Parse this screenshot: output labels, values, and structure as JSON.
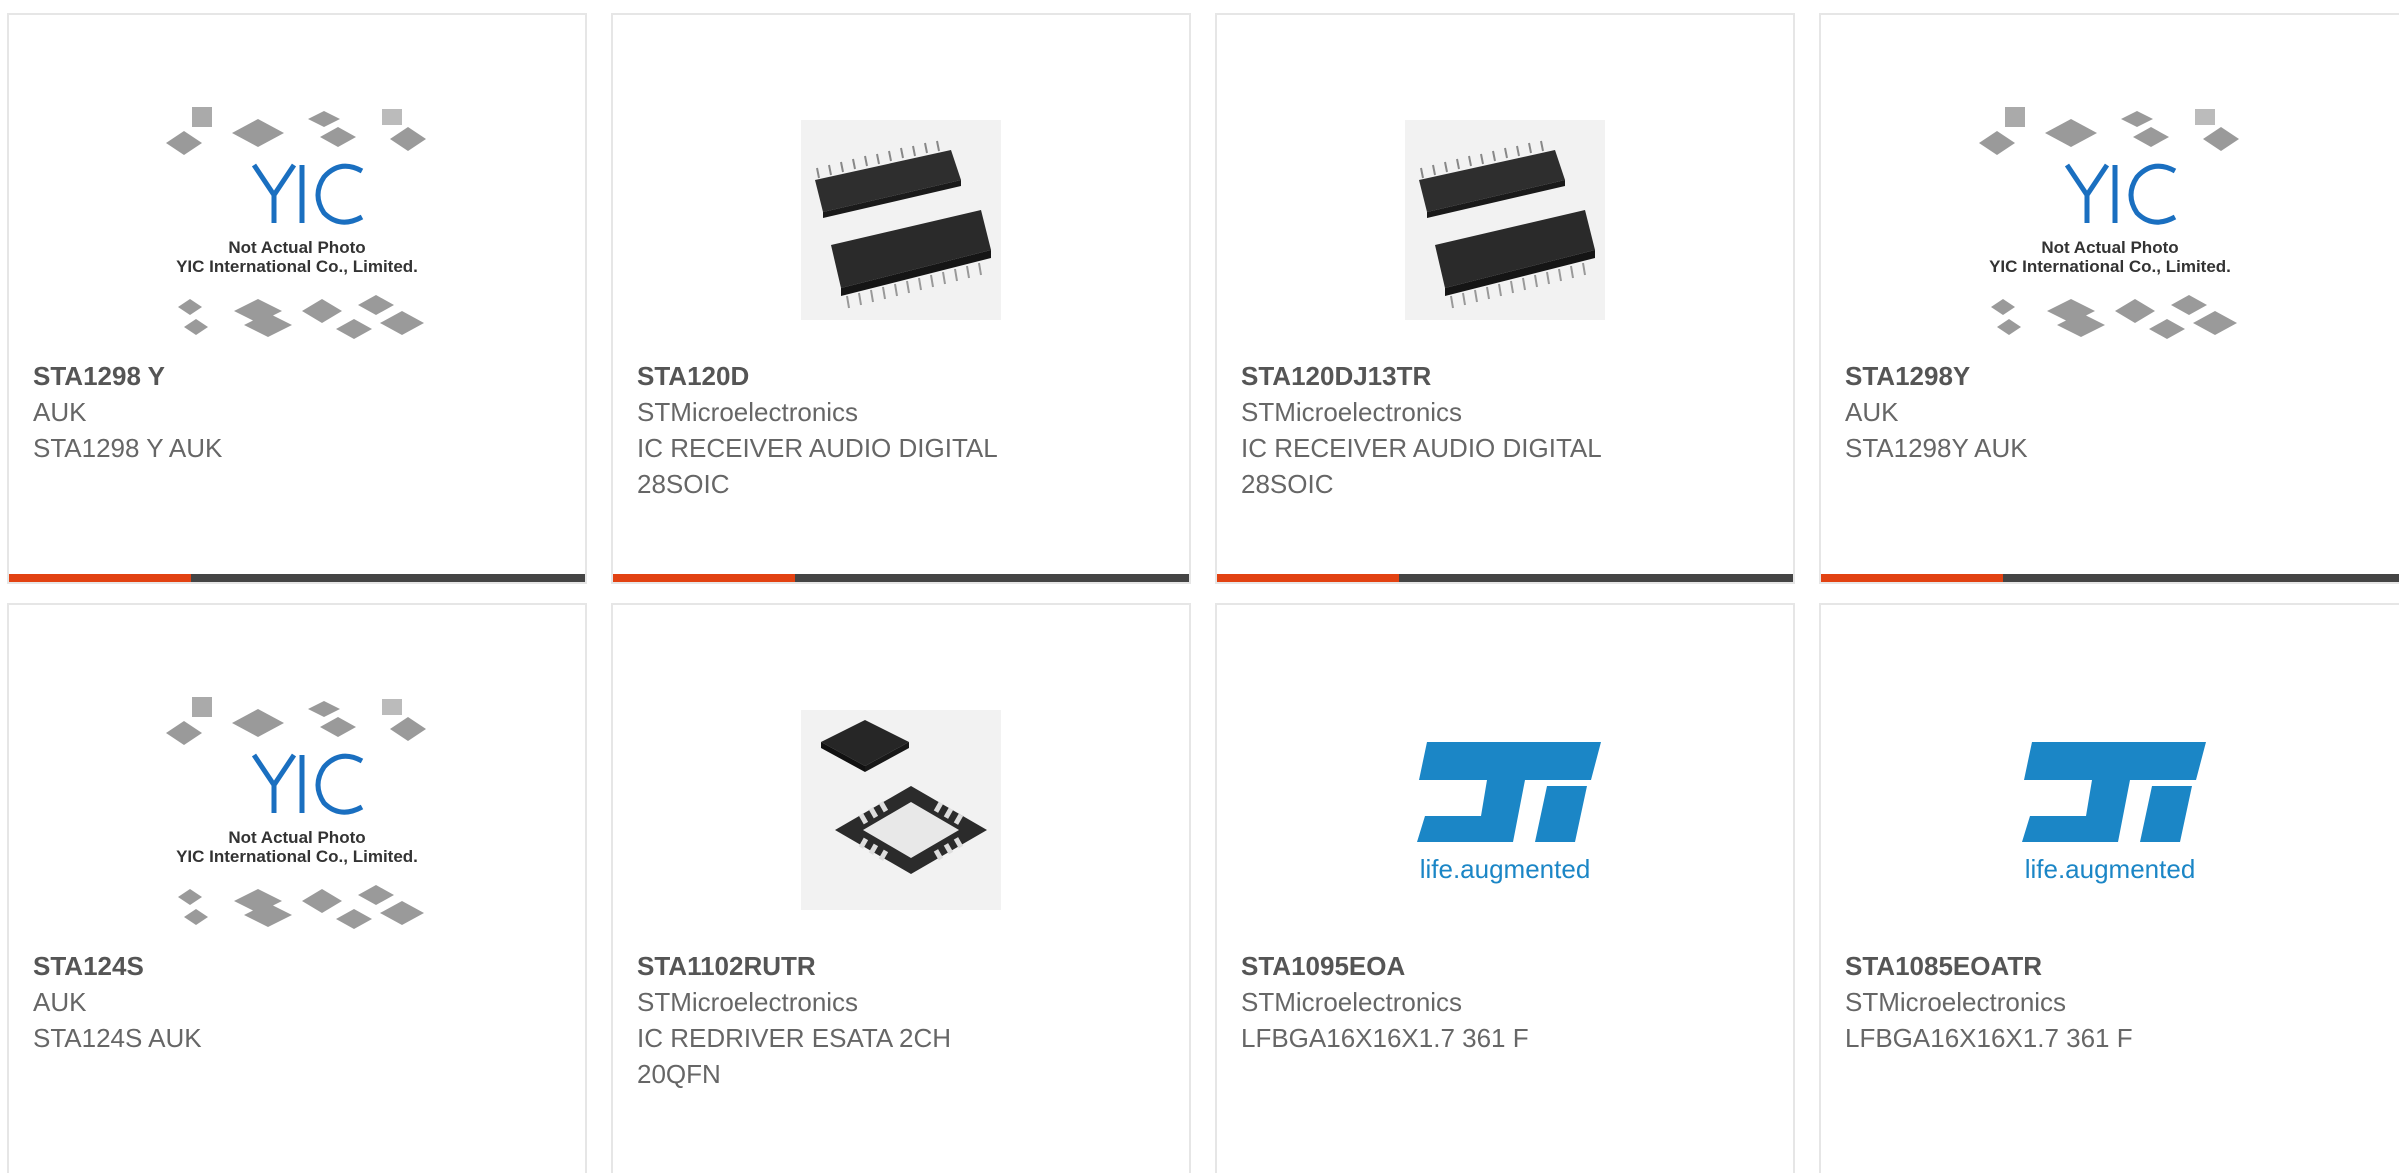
{
  "products": [
    {
      "part": "STA1298 Y",
      "maker": "AUK",
      "desc": "STA1298 Y AUK",
      "image": "yic-placeholder"
    },
    {
      "part": "STA120D",
      "maker": "STMicroelectronics",
      "desc": "IC RECEIVER AUDIO DIGITAL 28SOIC",
      "image": "soic-chip"
    },
    {
      "part": "STA120DJ13TR",
      "maker": "STMicroelectronics",
      "desc": "IC RECEIVER AUDIO DIGITAL 28SOIC",
      "image": "soic-chip"
    },
    {
      "part": "STA1298Y",
      "maker": "AUK",
      "desc": "STA1298Y AUK",
      "image": "yic-placeholder"
    },
    {
      "part": "STA124S",
      "maker": "AUK",
      "desc": "STA124S AUK",
      "image": "yic-placeholder"
    },
    {
      "part": "STA1102RUTR",
      "maker": "STMicroelectronics",
      "desc": "IC REDRIVER ESATA 2CH 20QFN",
      "image": "qfn-chip"
    },
    {
      "part": "STA1095EOA",
      "maker": "STMicroelectronics",
      "desc": "LFBGA16X16X1.7 361 F",
      "image": "st-logo"
    },
    {
      "part": "STA1085EOATR",
      "maker": "STMicroelectronics",
      "desc": "LFBGA16X16X1.7 361 F",
      "image": "st-logo"
    }
  ],
  "placeholder": {
    "line1": "Not Actual Photo",
    "line2": "YIC International Co., Limited."
  },
  "st_logo": {
    "tagline": "life.augmented"
  },
  "colors": {
    "accent": "#e24212",
    "bar": "#444444",
    "border": "#e6e6e6",
    "st_blue": "#1b86c6",
    "yic_blue": "#1a6fc0"
  }
}
